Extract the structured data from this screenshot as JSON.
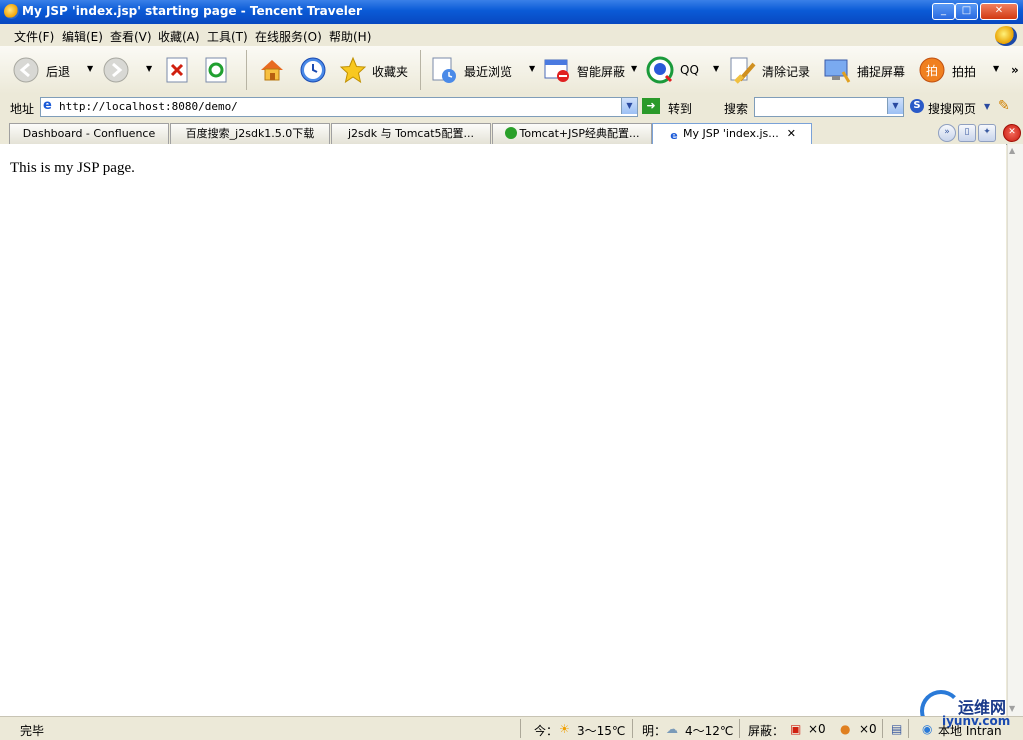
{
  "window": {
    "title": "My JSP 'index.jsp' starting page - Tencent Traveler",
    "controls": {
      "minimize": "_",
      "maximize": "□",
      "close": "✕"
    }
  },
  "menu": [
    {
      "label": "文件(F)"
    },
    {
      "label": "编辑(E)"
    },
    {
      "label": "查看(V)"
    },
    {
      "label": "收藏(A)"
    },
    {
      "label": "工具(T)"
    },
    {
      "label": "在线服务(O)"
    },
    {
      "label": "帮助(H)"
    }
  ],
  "toolbar": {
    "back": "后退",
    "favorites": "收藏夹",
    "recent": "最近浏览",
    "smart_block": "智能屏蔽",
    "qq": "QQ",
    "clear": "清除记录",
    "capture": "捕捉屏幕",
    "paipai": "拍拍",
    "more": "»"
  },
  "address": {
    "label": "地址",
    "url": "http://localhost:8080/demo/",
    "go": "转到",
    "search_label": "搜索",
    "search_value": "",
    "sougou": "搜搜网页"
  },
  "tabs": [
    {
      "label": "Dashboard - Confluence",
      "active": false
    },
    {
      "label": "百度搜索_j2sdk1.5.0下载",
      "active": false
    },
    {
      "label": "j2sdk 与 Tomcat5配置...",
      "active": false
    },
    {
      "label": "Tomcat+JSP经典配置...",
      "active": false
    },
    {
      "label": "My JSP 'index.js...",
      "active": true
    }
  ],
  "page": {
    "text": "This is my JSP page."
  },
  "status": {
    "state": "完毕",
    "today_label": "今：",
    "today_temp": "3～15℃",
    "tomorrow_label": "明：",
    "tomorrow_temp": "4～12℃",
    "blocked_label": "屏蔽：",
    "blocked_popups": "×0",
    "blocked_ads": "×0",
    "zone": "本地 Intran"
  },
  "watermark": {
    "name": "运维网",
    "url": "iyunv.com"
  },
  "colors": {
    "titlebar": "#0a5ad6",
    "chrome": "#ece9d8",
    "active_tab_border": "#7aa2d8"
  },
  "icons": [
    "back-icon",
    "forward-icon",
    "stop-icon",
    "refresh-icon",
    "home-icon",
    "history-icon",
    "favorites-icon",
    "recent-icon",
    "smart-block-icon",
    "qq-icon",
    "clear-icon",
    "capture-icon",
    "paipai-icon"
  ]
}
